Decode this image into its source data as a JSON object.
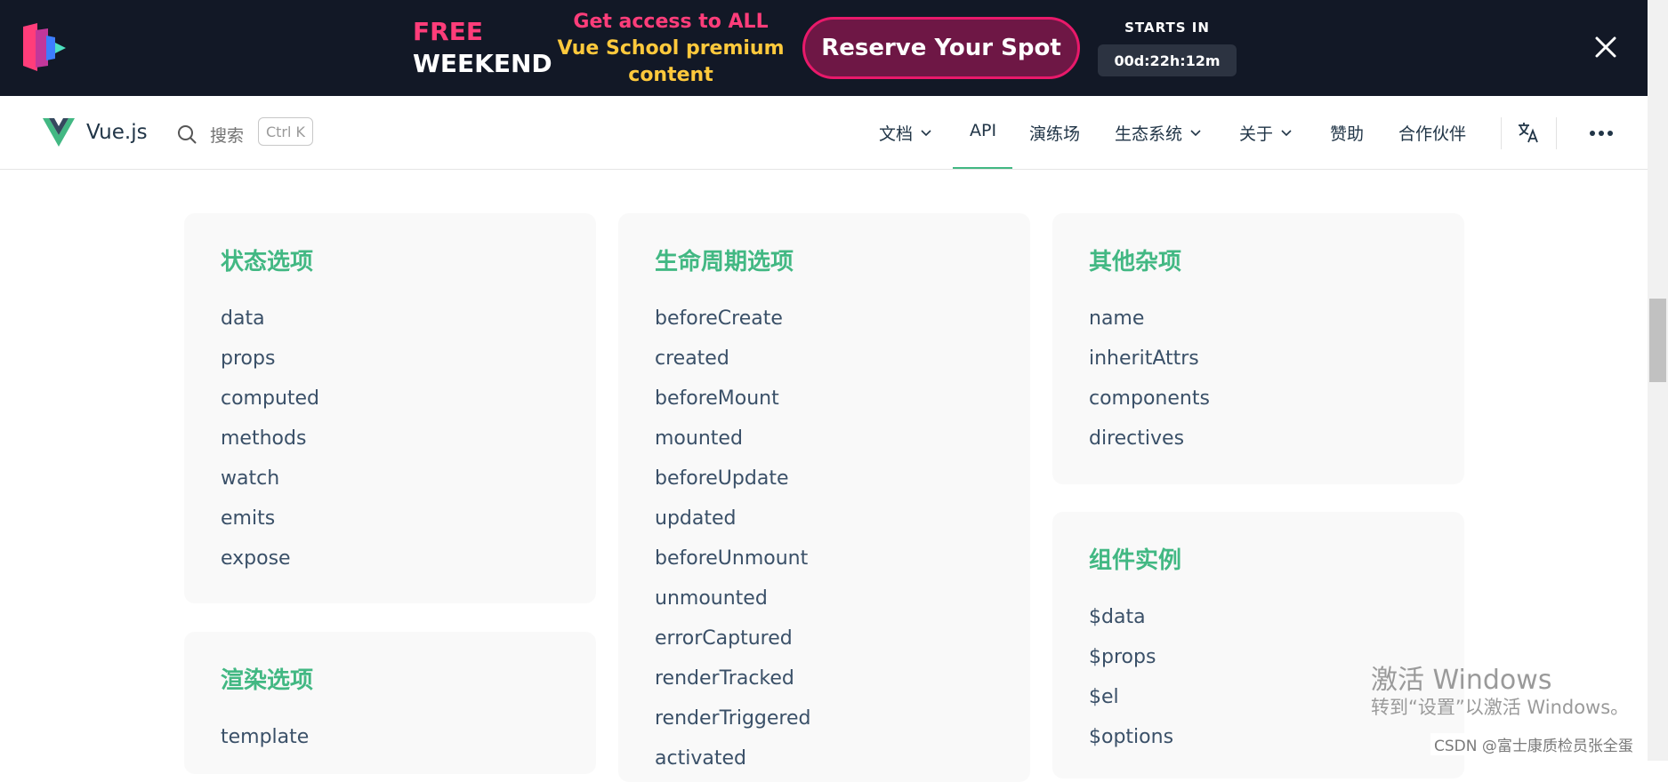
{
  "banner": {
    "free": "FREE",
    "weekend": "WEEKEND",
    "offer_line1": "Get access to ALL",
    "offer_line2": "Vue School premium",
    "offer_line3": "content",
    "cta": "Reserve Your Spot",
    "starts_label": "STARTS IN",
    "countdown": "00d:22h:12m",
    "colors": {
      "accent": "#ff3d7a",
      "gold": "#ffc93c",
      "background": "#121826"
    }
  },
  "nav": {
    "brand": "Vue.js",
    "search_placeholder": "搜索",
    "search_shortcut": "Ctrl K",
    "items": [
      {
        "label": "文档",
        "dropdown": true
      },
      {
        "label": "API",
        "dropdown": false,
        "active": true
      },
      {
        "label": "演练场",
        "dropdown": false
      },
      {
        "label": "生态系统",
        "dropdown": true
      },
      {
        "label": "关于",
        "dropdown": true
      },
      {
        "label": "赞助",
        "dropdown": false
      },
      {
        "label": "合作伙伴",
        "dropdown": false
      }
    ],
    "icons": [
      "search-icon",
      "translate-icon",
      "more-icon"
    ],
    "accent": "#42b883"
  },
  "cards": {
    "state": {
      "title": "状态选项",
      "items": [
        "data",
        "props",
        "computed",
        "methods",
        "watch",
        "emits",
        "expose"
      ]
    },
    "lifecycle": {
      "title": "生命周期选项",
      "items": [
        "beforeCreate",
        "created",
        "beforeMount",
        "mounted",
        "beforeUpdate",
        "updated",
        "beforeUnmount",
        "unmounted",
        "errorCaptured",
        "renderTracked",
        "renderTriggered",
        "activated"
      ]
    },
    "misc": {
      "title": "其他杂项",
      "items": [
        "name",
        "inheritAttrs",
        "components",
        "directives"
      ]
    },
    "render": {
      "title": "渲染选项",
      "items": [
        "template"
      ]
    },
    "instance": {
      "title": "组件实例",
      "items": [
        "$data",
        "$props",
        "$el",
        "$options"
      ]
    }
  },
  "watermark": {
    "line1": "激活 Windows",
    "line2": "转到“设置”以激活 Windows。",
    "credit": "CSDN @富士康质检员张全蛋"
  }
}
